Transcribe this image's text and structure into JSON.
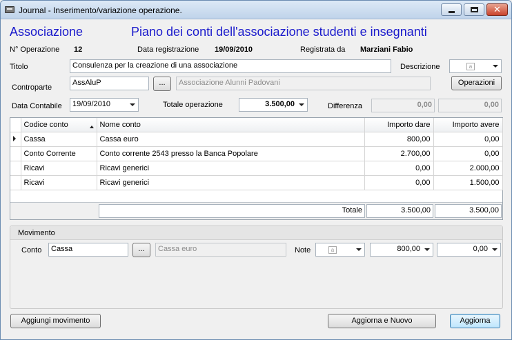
{
  "window": {
    "title": "Journal - Inserimento/variazione operazione."
  },
  "header": {
    "left_title": "Associazione",
    "main_title": "Piano dei conti dell'associazione studenti e insegnanti"
  },
  "info": {
    "op_label": "N° Operazione",
    "op_value": "12",
    "date_label": "Data registrazione",
    "date_value": "19/09/2010",
    "by_label": "Registrata da",
    "by_value": "Marziani Fabio"
  },
  "form": {
    "titolo_label": "Titolo",
    "titolo_value": "Consulenza per la creazione di una associazione",
    "descrizione_label": "Descrizione",
    "controparte_label": "Controparte",
    "controparte_code": "AssAluP",
    "browse_label": "...",
    "controparte_name": "Associazione Alunni Padovani",
    "operazioni_button": "Operazioni",
    "data_contabile_label": "Data Contabile",
    "data_contabile_value": "19/09/2010",
    "totale_label": "Totale operazione",
    "totale_value": "3.500,00",
    "differenza_label": "Differenza",
    "differenza_value1": "0,00",
    "differenza_value2": "0,00"
  },
  "grid": {
    "columns": [
      "Codice conto",
      "Nome conto",
      "Importo dare",
      "Importo avere"
    ],
    "rows": [
      {
        "codice": "Cassa",
        "nome": "Cassa euro",
        "dare": "800,00",
        "avere": "0,00"
      },
      {
        "codice": "Conto Corrente",
        "nome": "Conto corrente 2543 presso la Banca Popolare",
        "dare": "2.700,00",
        "avere": "0,00"
      },
      {
        "codice": "Ricavi",
        "nome": "Ricavi generici",
        "dare": "0,00",
        "avere": "2.000,00"
      },
      {
        "codice": "Ricavi",
        "nome": "Ricavi generici",
        "dare": "0,00",
        "avere": "1.500,00"
      }
    ],
    "totale_label": "Totale",
    "totale_dare": "3.500,00",
    "totale_avere": "3.500,00"
  },
  "movimento": {
    "title": "Movimento",
    "conto_label": "Conto",
    "conto_value": "Cassa",
    "browse_label": "...",
    "conto_name": "Cassa euro",
    "note_label": "Note",
    "dare_value": "800,00",
    "avere_value": "0,00"
  },
  "buttons": {
    "aggiungi": "Aggiungi movimento",
    "aggiorna_nuovo": "Aggiorna e Nuovo",
    "aggiorna": "Aggiorna"
  },
  "icons": {
    "app": "journal-app-icon",
    "note": "note-page-icon",
    "dropdown": "chevron-down-icon",
    "row_pointer": "row-pointer-icon",
    "sort": "sort-ascending-icon"
  }
}
